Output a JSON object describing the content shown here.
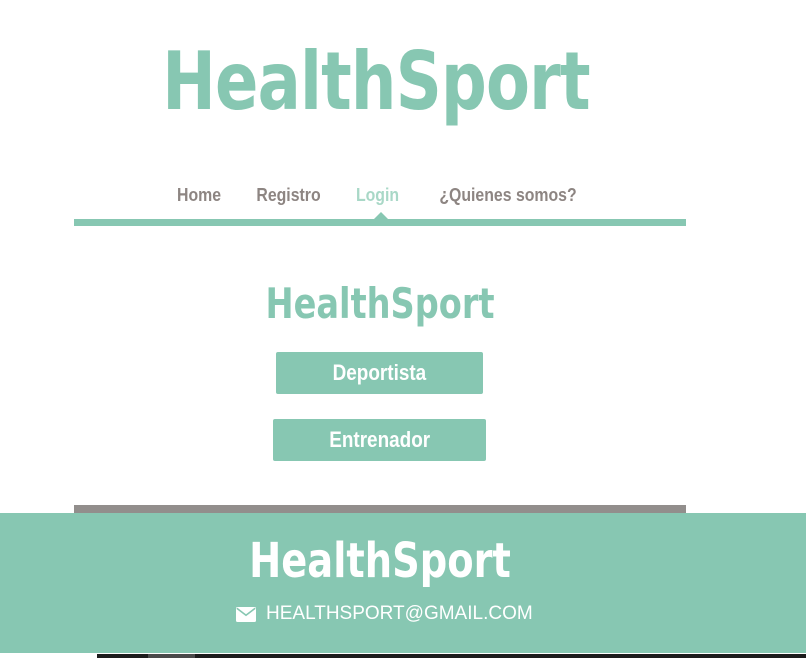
{
  "header": {
    "logo_text": "HealthSport"
  },
  "nav": {
    "items": [
      {
        "label": "Home",
        "active": false
      },
      {
        "label": "Registro",
        "active": false
      },
      {
        "label": "Login",
        "active": true
      },
      {
        "label": "¿Quienes somos?",
        "active": false
      }
    ]
  },
  "main": {
    "title": "HealthSport",
    "buttons": {
      "deportista": "Deportista",
      "entrenador": "Entrenador"
    }
  },
  "footer": {
    "title": "HealthSport",
    "email_icon": "envelope-icon",
    "email": "HEALTHSPORT@GMAIL.COM"
  },
  "colors": {
    "accent": "#87c7b2",
    "nav_text": "#8d8582",
    "nav_active": "#a9d8c7",
    "divider_gray": "#928e8c"
  }
}
